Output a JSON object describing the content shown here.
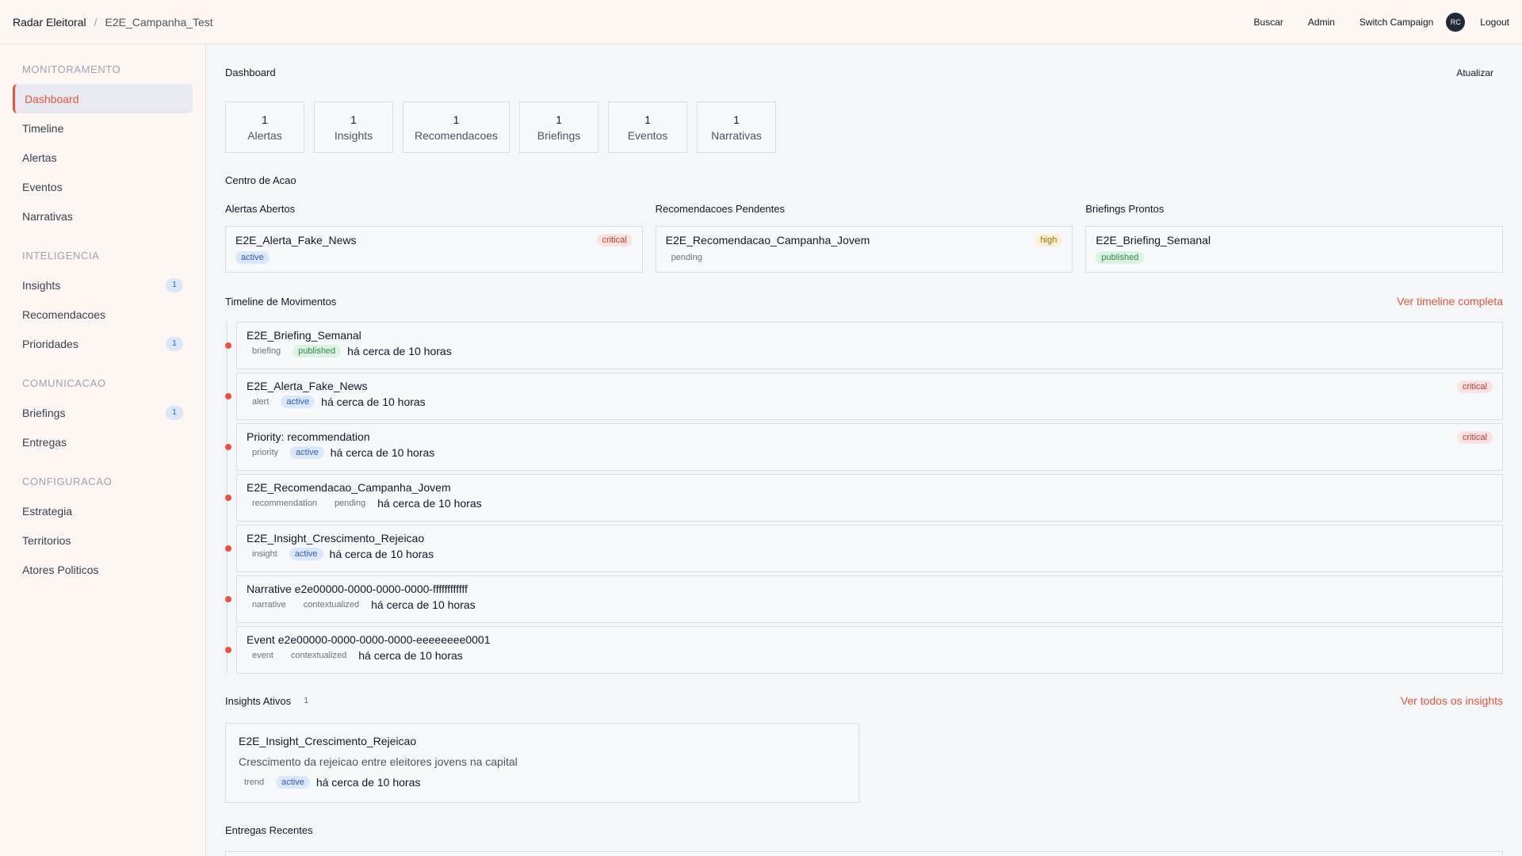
{
  "header": {
    "brand": "Radar Eleitoral",
    "separator": "/",
    "campaign": "E2E_Campanha_Test",
    "actions": [
      "Buscar",
      "Admin",
      "Switch Campaign"
    ],
    "avatar": "RC",
    "logout": "Logout"
  },
  "sidebar": {
    "sections": [
      {
        "heading": "MONITORAMENTO",
        "items": [
          {
            "label": "Dashboard",
            "badge": ""
          },
          {
            "label": "Timeline",
            "badge": ""
          },
          {
            "label": "Alertas",
            "badge": ""
          },
          {
            "label": "Eventos",
            "badge": ""
          },
          {
            "label": "Narrativas",
            "badge": ""
          }
        ]
      },
      {
        "heading": "INTELIGENCIA",
        "items": [
          {
            "label": "Insights",
            "badge": "1"
          },
          {
            "label": "Recomendacoes",
            "badge": ""
          },
          {
            "label": "Prioridades",
            "badge": "1"
          }
        ]
      },
      {
        "heading": "COMUNICACAO",
        "items": [
          {
            "label": "Briefings",
            "badge": "1"
          },
          {
            "label": "Entregas",
            "badge": ""
          }
        ]
      },
      {
        "heading": "CONFIGURACAO",
        "items": [
          {
            "label": "Estrategia",
            "badge": ""
          },
          {
            "label": "Territorios",
            "badge": ""
          },
          {
            "label": "Atores Politicos",
            "badge": ""
          }
        ]
      }
    ]
  },
  "main": {
    "title": "Dashboard",
    "refresh": "Atualizar",
    "stats": [
      {
        "value": "1",
        "label": "Alertas"
      },
      {
        "value": "1",
        "label": "Insights"
      },
      {
        "value": "1",
        "label": "Recomendacoes"
      },
      {
        "value": "1",
        "label": "Briefings"
      },
      {
        "value": "1",
        "label": "Eventos"
      },
      {
        "value": "1",
        "label": "Narrativas"
      }
    ],
    "centro_title": "Centro de Acao",
    "alertas": {
      "title": "Alertas Abertos",
      "item": "E2E_Alerta_Fake_News",
      "status": "active",
      "severity": "critical"
    },
    "recomendacoes": {
      "title": "Recomendacoes Pendentes",
      "item": "E2E_Recomendacao_Campanha_Jovem",
      "status": "pending",
      "severity": "high"
    },
    "briefings": {
      "title": "Briefings Prontos",
      "item": "E2E_Briefing_Semanal",
      "status": "published"
    },
    "timeline_title": "Timeline de Movimentos",
    "timeline_link": "Ver timeline completa",
    "timeline": [
      {
        "title": "E2E_Briefing_Semanal",
        "type": "briefing",
        "status": "published",
        "time": "há cerca de 10 horas",
        "severity": ""
      },
      {
        "title": "E2E_Alerta_Fake_News",
        "type": "alert",
        "status": "active",
        "time": "há cerca de 10 horas",
        "severity": "critical"
      },
      {
        "title": "Priority: recommendation",
        "type": "priority",
        "status": "active",
        "time": "há cerca de 10 horas",
        "severity": "critical"
      },
      {
        "title": "E2E_Recomendacao_Campanha_Jovem",
        "type": "recommendation",
        "status": "pending",
        "time": "há cerca de 10 horas",
        "severity": ""
      },
      {
        "title": "E2E_Insight_Crescimento_Rejeicao",
        "type": "insight",
        "status": "active",
        "time": "há cerca de 10 horas",
        "severity": ""
      },
      {
        "title": "Narrative e2e00000-0000-0000-0000-ffffffffffff",
        "type": "narrative",
        "status": "contextualized",
        "time": "há cerca de 10 horas",
        "severity": ""
      },
      {
        "title": "Event e2e00000-0000-0000-0000-eeeeeeee0001",
        "type": "event",
        "status": "contextualized",
        "time": "há cerca de 10 horas",
        "severity": ""
      }
    ],
    "insights_title": "Insights Ativos",
    "insights_count": "1",
    "insights_link": "Ver todos os insights",
    "insight": {
      "title": "E2E_Insight_Crescimento_Rejeicao",
      "description": "Crescimento da rejeicao entre eleitores jovens na capital",
      "type": "trend",
      "status": "active",
      "time": "há cerca de 10 horas"
    },
    "entregas_title": "Entregas Recentes"
  }
}
